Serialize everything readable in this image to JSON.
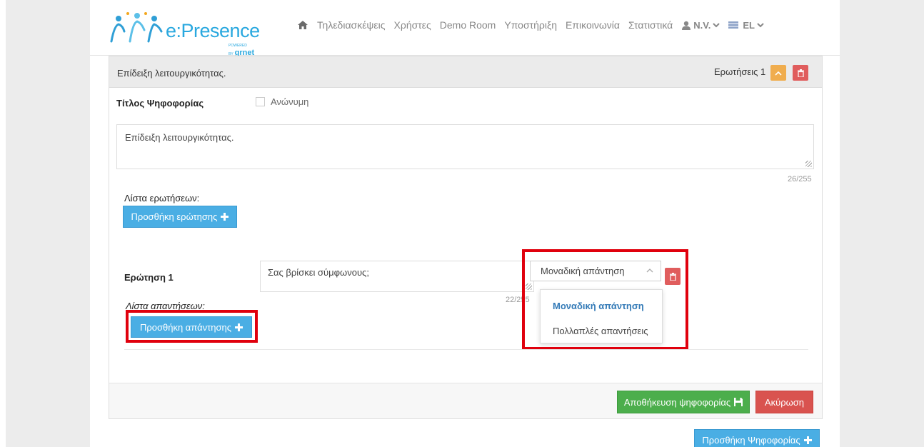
{
  "nav": {
    "logo_text": "e:Presence",
    "logo_powered": "POWERED BY",
    "logo_sub": "grnet",
    "items": [
      "Τηλεδιασκέψεις",
      "Χρήστες",
      "Demo Room",
      "Υποστήριξη",
      "Επικοινωνία",
      "Στατιστικά"
    ],
    "user": "N.V.",
    "language": "EL"
  },
  "poll": {
    "header_title": "Επίδειξη λειτουργικότητας.",
    "questions_count": "Ερωτήσεις 1",
    "title_label": "Τίτλος Ψηφοφορίας",
    "anonymous_label": "Ανώνυμη",
    "title_value": "Επίδειξη λειτουργικότητας.",
    "title_counter": "26/255",
    "questions_list_label": "Λίστα ερωτήσεων:",
    "add_question_label": "Προσθήκη ερώτησης",
    "question": {
      "label": "Ερώτηση 1",
      "value": "Σας βρίσκει σύμφωνους;",
      "counter": "22/255",
      "type_selected": "Μοναδική απάντηση",
      "type_options": [
        "Μοναδική απάντηση",
        "Πολλαπλές απαντήσεις"
      ],
      "answers_list_label": "Λίστα απαντήσεων:",
      "add_answer_label": "Προσθήκη απάντησης"
    },
    "save_label": "Αποθήκευση ψηφοφορίας",
    "cancel_label": "Ακύρωση"
  },
  "add_poll_label": "Προσθήκη Ψηφοφορίας",
  "colors": {
    "brand": "#29a8df",
    "primary_button": "#4aaee4",
    "success": "#4cae4c",
    "danger": "#d9534f",
    "warning": "#f0ad4e",
    "highlight": "#e0000d"
  }
}
